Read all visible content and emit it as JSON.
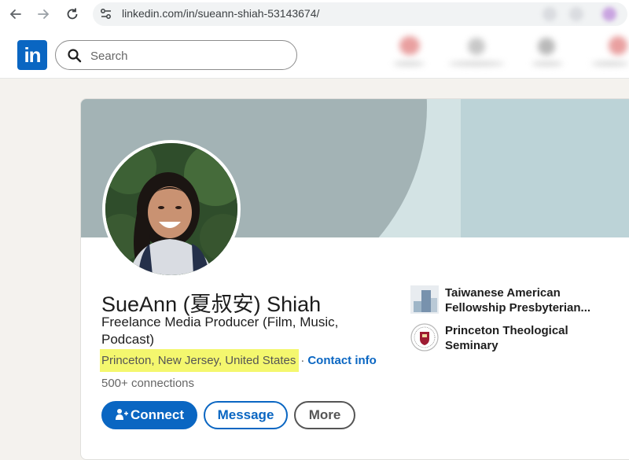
{
  "browser": {
    "url": "linkedin.com/in/sueann-shiah-53143674/"
  },
  "header": {
    "logo_text": "in",
    "search_placeholder": "Search"
  },
  "profile": {
    "name": "SueAnn (夏叔安) Shiah",
    "headline": "Freelance Media Producer (Film, Music, Podcast)",
    "location": "Princeton, New Jersey, United States",
    "separator": "·",
    "contact_info": "Contact info",
    "connections_count": "500+",
    "connections_label": "connections"
  },
  "actions": {
    "connect": "Connect",
    "message": "Message",
    "more": "More"
  },
  "organizations": [
    {
      "name": "Taiwanese American Fellowship Presbyterian...",
      "icon": "building-logo"
    },
    {
      "name": "Princeton Theological Seminary",
      "icon": "seminary-seal-logo"
    }
  ],
  "colors": {
    "brand": "#0a66c2",
    "highlight": "#f4f76e",
    "banner": "#a3b3b5"
  }
}
